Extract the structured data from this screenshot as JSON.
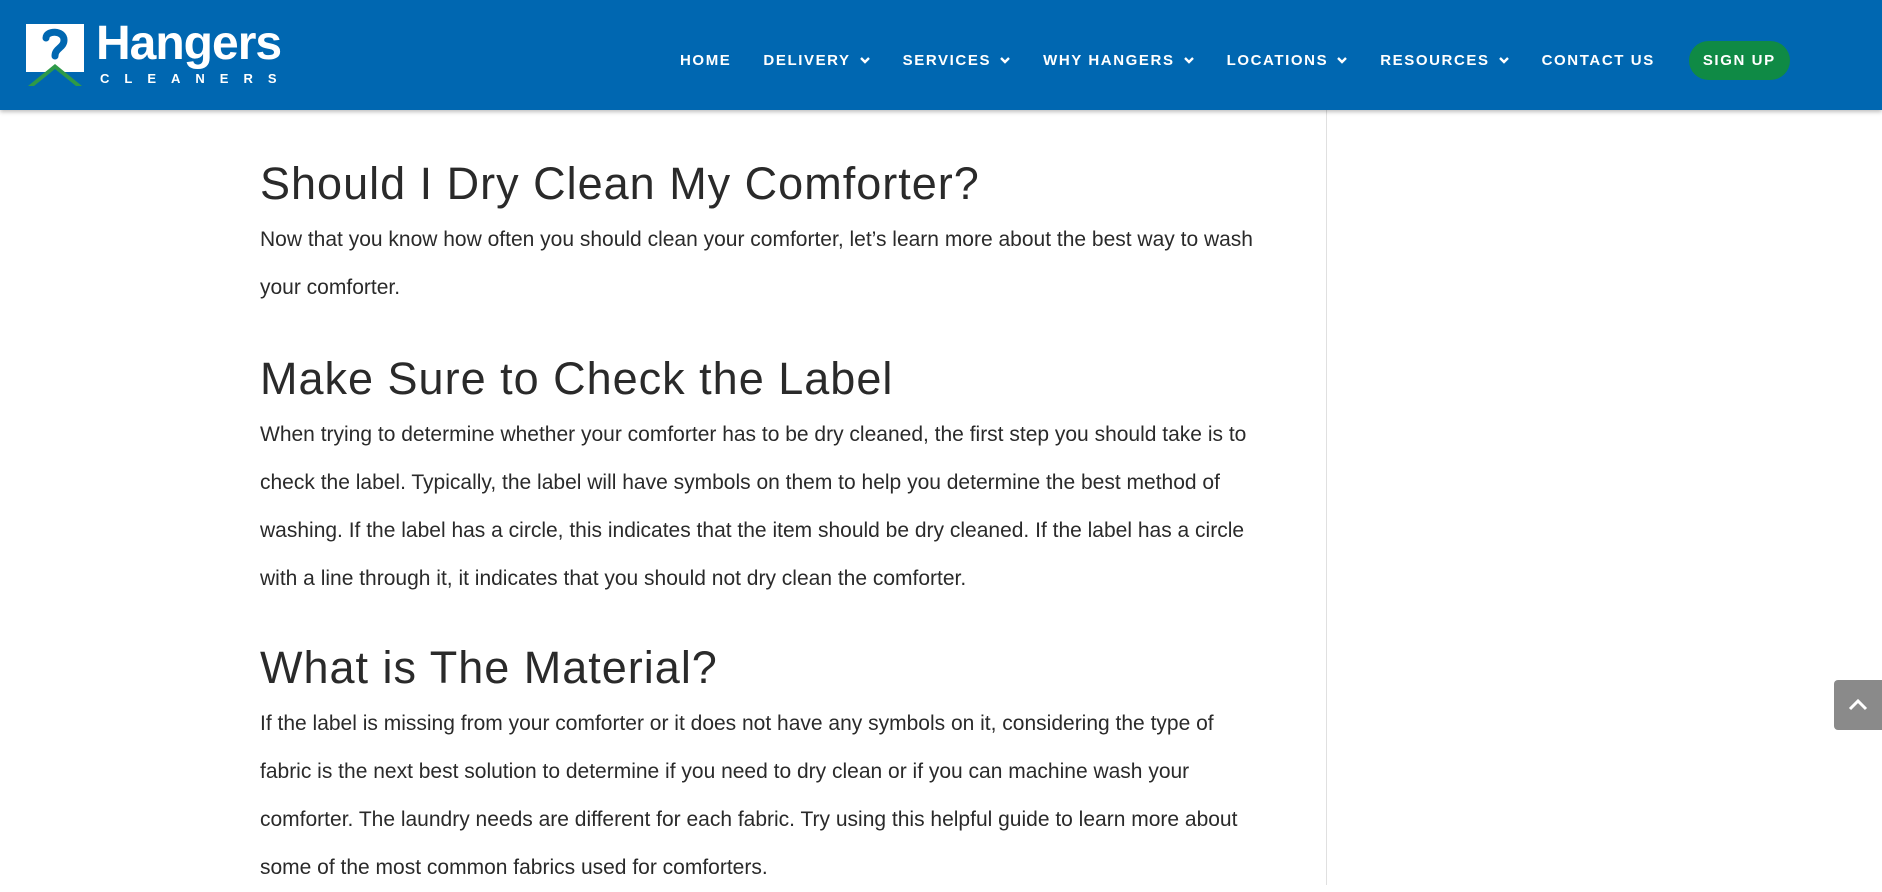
{
  "header": {
    "logo_word": "Hangers",
    "logo_sub": "CLEANERS",
    "nav": [
      {
        "label": "HOME",
        "has_dropdown": false
      },
      {
        "label": "DELIVERY",
        "has_dropdown": true
      },
      {
        "label": "SERVICES",
        "has_dropdown": true
      },
      {
        "label": "WHY HANGERS",
        "has_dropdown": true
      },
      {
        "label": "LOCATIONS",
        "has_dropdown": true
      },
      {
        "label": "RESOURCES",
        "has_dropdown": true
      },
      {
        "label": "CONTACT US",
        "has_dropdown": false
      }
    ],
    "signup_label": "SIGN UP"
  },
  "article": {
    "sections": [
      {
        "heading": "Should I Dry Clean My Comforter?",
        "body": "Now that you know how often you should clean your comforter, let’s learn more about the best way to wash your comforter."
      },
      {
        "heading": "Make Sure to Check the Label",
        "body": "When trying to determine whether your comforter has to be dry cleaned, the first step you should take is to check the label. Typically, the label will have symbols on them to help you determine the best method of washing. If the label has a circle, this indicates that the item should be dry cleaned. If the label has a circle with a line through it, it indicates that you should not dry clean the comforter."
      },
      {
        "heading": "What is The Material?",
        "body": "If the label is missing from your comforter or it does not have any symbols on it, considering the type of fabric is the next best solution to determine if you need to dry clean or if you can machine wash your comforter. The laundry needs are different for each fabric. Try using this helpful guide to learn more about some of the most common fabrics used for comforters."
      }
    ]
  },
  "icons": {
    "logo_mark": "hangers-logo-icon",
    "dropdown": "chevron-down-icon",
    "back_to_top": "chevron-up-icon"
  },
  "colors": {
    "header_bg": "#0067b1",
    "signup_bg": "#0f8a45",
    "text": "#2a2a2a",
    "back_to_top_bg": "#8a8a8a"
  }
}
